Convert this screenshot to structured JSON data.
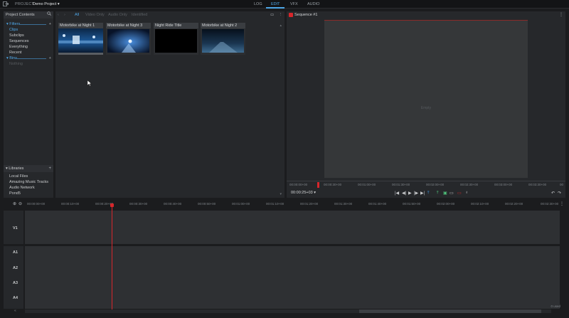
{
  "topbar": {
    "project_label": "PROJECT",
    "project_name": "Demo Project ▾",
    "tabs": [
      {
        "label": "LOG",
        "active": false
      },
      {
        "label": "EDIT",
        "active": true
      },
      {
        "label": "VFX",
        "active": false
      },
      {
        "label": "AUDIO",
        "active": false
      }
    ],
    "accent": "#4fa8e8"
  },
  "left_panel": {
    "title": "Project Contents",
    "filters_label": "Filters",
    "filters": [
      {
        "label": "Clips",
        "active": true
      },
      {
        "label": "Subclips",
        "active": false
      },
      {
        "label": "Sequences",
        "active": false
      },
      {
        "label": "Everything",
        "active": false
      },
      {
        "label": "Recent",
        "active": false
      }
    ],
    "bins_label": "Bins",
    "bins_empty": "Nothing",
    "libraries_title": "Libraries",
    "libraries": [
      "Local Files",
      "Amazing Music Tracks",
      "Audio Network",
      "Pond5"
    ]
  },
  "browser": {
    "filters": [
      "All",
      "Video Only",
      "Audio Only",
      "Identified"
    ],
    "clips": [
      {
        "title": "Motorbike at Night 1"
      },
      {
        "title": "Motorbike at Night 3"
      },
      {
        "title": "Night Ride Title"
      },
      {
        "title": "Motorbike at Night 2"
      }
    ]
  },
  "viewer": {
    "sequence_name": "Sequence #1",
    "empty_label": "Empty",
    "ruler": [
      "00:00:00+00",
      "00:00:30+00",
      "00:01:00+00",
      "00:01:30+00",
      "00:02:00+00",
      "00:02:30+00",
      "00:03:00+00",
      "00:03:30+00",
      "00:04:00+00",
      "00:04:30+00",
      "00"
    ],
    "timecode": "00:00:25+03 ▾",
    "record_color": "#d7262b"
  },
  "timeline": {
    "ruler": [
      "00:00:00+00",
      "00:00:10+00",
      "00:00:20+00",
      "00:00:30+00",
      "00:00:40+00",
      "00:00:50+00",
      "00:01:00+00",
      "00:01:10+00",
      "00:01:20+00",
      "00:01:30+00",
      "00:01:40+00",
      "00:01:50+00",
      "00:02:00+00",
      "00:02:10+00",
      "00:02:20+00",
      "00:02:30+00"
    ],
    "tracks": [
      "V1",
      "A1",
      "A2",
      "A3",
      "A4"
    ],
    "used_label": "0 used",
    "playhead_color": "#d7262b"
  }
}
